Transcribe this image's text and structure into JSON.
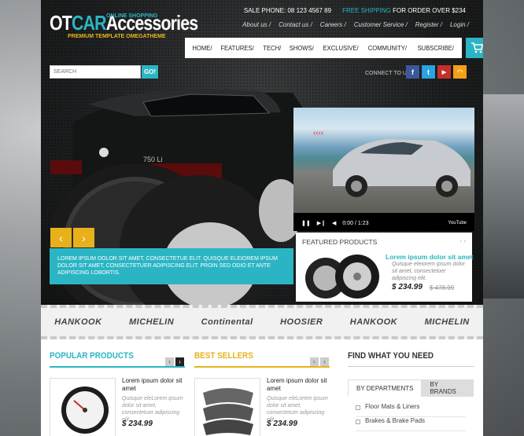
{
  "header": {
    "logo_ot": "OT",
    "logo_car": "CAR",
    "logo_acc": "Accessories",
    "logo_tag1": "ONLINE SHOPPING",
    "logo_tag2": "PREMIUM TEMPLATE OMEGATHEME",
    "sale_phone": "SALE PHONE: 08 123 4567 89",
    "free_shipping": "FREE SHIPPING",
    "free_shipping_rest": " FOR ORDER OVER $234",
    "top_links": [
      "About us /",
      "Contact us /",
      "Careers /",
      "Customer Service /",
      "Register /",
      "Login /"
    ]
  },
  "nav": {
    "items": [
      "HOME/",
      "FEATURES/",
      "TECH/",
      "SHOWS/",
      "EXCLUSIVE/",
      "COMMUNITY/",
      "SUBSCRIBE/"
    ]
  },
  "search": {
    "placeholder": "SEARCH",
    "button": "GO!"
  },
  "social": {
    "connect_label": "CONNECT TO US:",
    "icons": [
      "facebook-icon",
      "twitter-icon",
      "youtube-icon",
      "rss-icon"
    ]
  },
  "hero": {
    "caption": "LOREM IPSUM DOLOR SIT AMET, CONSECTETUE ELIT. QUISQUE ELEIOREM IPSUM DOLOR SIT AMET, CONSECTETUER ADIPISCING ELIT. PROIN SED ODIO ET ANTE ADIPISCING LOBORTIS.",
    "time": "0:00 / 1:23",
    "video_brand": "YouTube"
  },
  "featured": {
    "title": "FEATURED PRODUCTS",
    "product_name": "Lorem ipsum dolor sit amet",
    "product_desc": "Quisque eleiorem ipsum dolor sit amet, consectetuer adipiscing elit.",
    "price": "$ 234.99",
    "old_price": "$ 478.99"
  },
  "brands": [
    "HANKOOK",
    "MICHELIN",
    "Continental",
    "HOOSIER",
    "HANKOOK",
    "MICHELIN"
  ],
  "popular": {
    "title": "POPULAR PRODUCTS",
    "product_name": "Lorem ipsum dolor sit amet",
    "product_desc": "Quisque eleLorem ipsum dolor sit amet, consectetuer adipiscing elit.",
    "price": "$ 234.99"
  },
  "bestsellers": {
    "title": "BEST SELLERS",
    "product_name": "Lorem ipsum dolor sit amet",
    "product_desc": "Quisque eleLorem ipsum dolor sit amet, consectetuer adipiscing elit.",
    "price": "$ 234.99"
  },
  "find": {
    "title": "FIND WHAT YOU NEED",
    "tab1": "BY DEPARTMENTS",
    "tab2": "BY BRANDS",
    "categories": [
      "Floor Mats & Liners",
      "Brakes & Brake Pads"
    ]
  },
  "colors": {
    "accent": "#2bb5c4",
    "yellow": "#e8b11c"
  }
}
